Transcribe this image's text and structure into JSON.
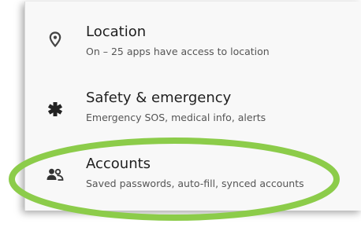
{
  "settings": {
    "items": [
      {
        "icon": "location-pin-icon",
        "title": "Location",
        "subtitle": "On – 25 apps have access to location"
      },
      {
        "icon": "asterisk-icon",
        "title": "Safety & emergency",
        "subtitle": "Emergency SOS, medical info, alerts"
      },
      {
        "icon": "accounts-icon",
        "title": "Accounts",
        "subtitle": "Saved passwords, auto-fill, synced accounts"
      }
    ]
  },
  "colors": {
    "highlight": "#8ccc4a",
    "panel_background": "#f8f8f8",
    "title_text": "#1f1f1f",
    "subtitle_text": "#555555",
    "icon": "#444444"
  }
}
